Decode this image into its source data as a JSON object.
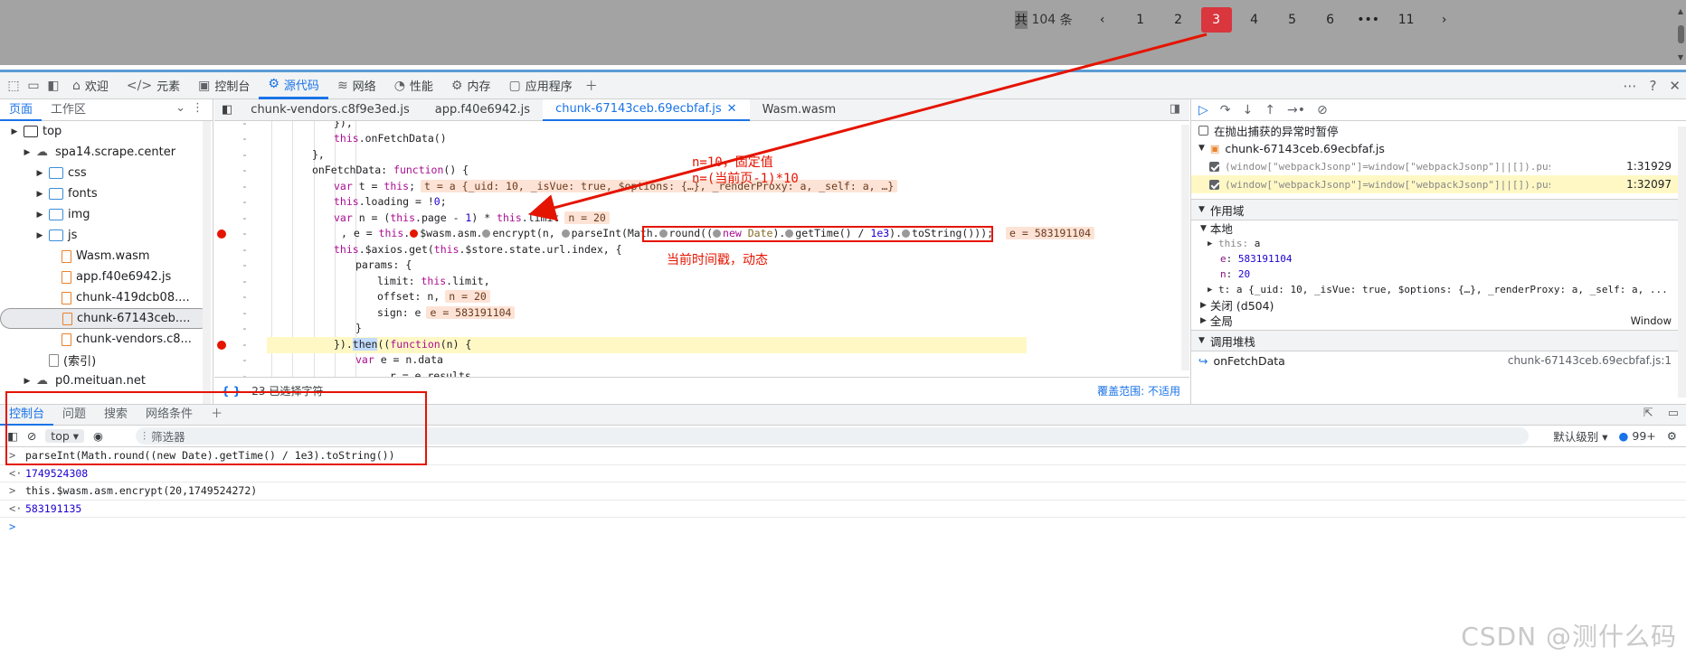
{
  "pagination": {
    "total_prefix": "共",
    "total_count": "104",
    "total_suffix": "条",
    "prev": "‹",
    "pages": [
      "1",
      "2",
      "3",
      "4",
      "5",
      "6",
      "•••",
      "11"
    ],
    "active": "3",
    "next": "›"
  },
  "devtools": {
    "main_tabs": [
      {
        "label": "欢迎",
        "icon": "⌂"
      },
      {
        "label": "元素",
        "icon": "</>"
      },
      {
        "label": "控制台",
        "icon": "▣"
      },
      {
        "label": "源代码",
        "icon": "⚙"
      },
      {
        "label": "网络",
        "icon": "≋"
      },
      {
        "label": "性能",
        "icon": "◔"
      },
      {
        "label": "内存",
        "icon": "⚙"
      },
      {
        "label": "应用程序",
        "icon": "▢"
      }
    ],
    "selected_main_tab": "源代码",
    "nav_tabs": [
      "页面",
      "工作区"
    ],
    "tree": [
      {
        "label": "top",
        "level": 0,
        "type": "frame",
        "arrow": "▶"
      },
      {
        "label": "spa14.scrape.center",
        "level": 1,
        "type": "cloud",
        "arrow": "▶"
      },
      {
        "label": "css",
        "level": 2,
        "type": "folder",
        "arrow": "▶"
      },
      {
        "label": "fonts",
        "level": 2,
        "type": "folder",
        "arrow": "▶"
      },
      {
        "label": "img",
        "level": 2,
        "type": "folder",
        "arrow": "▶"
      },
      {
        "label": "js",
        "level": 2,
        "type": "folder",
        "arrow": "▶"
      },
      {
        "label": "Wasm.wasm",
        "level": 3,
        "type": "file",
        "arrow": ""
      },
      {
        "label": "app.f40e6942.js",
        "level": 3,
        "type": "file",
        "arrow": ""
      },
      {
        "label": "chunk-419dcb08....",
        "level": 3,
        "type": "file",
        "arrow": ""
      },
      {
        "label": "chunk-67143ceb....",
        "level": 3,
        "type": "file",
        "arrow": "",
        "selected": true
      },
      {
        "label": "chunk-vendors.c8...",
        "level": 3,
        "type": "file",
        "arrow": ""
      },
      {
        "label": "(索引)",
        "level": 2,
        "type": "file-grey",
        "arrow": ""
      },
      {
        "label": "p0.meituan.net",
        "level": 1,
        "type": "cloud",
        "arrow": "▶"
      }
    ],
    "file_tabs": [
      {
        "label": "chunk-vendors.c8f9e3ed.js"
      },
      {
        "label": "app.f40e6942.js"
      },
      {
        "label": "chunk-67143ceb.69ecbfaf.js",
        "selected": true,
        "close": "✕"
      },
      {
        "label": "Wasm.wasm"
      }
    ],
    "editor_status": {
      "brace": "{ }",
      "selected": "23 已选择字符",
      "coverage": "覆盖范围: 不适用"
    },
    "annotations": {
      "n_note_1": "n=10，固定值",
      "n_note_2": "n=(当前页-1)*10",
      "ts_note": "当前时间戳，动态"
    },
    "debugger": {
      "pause_on_caught": "在抛出捕获的异常时暂停",
      "bp_file": "chunk-67143ceb.69ecbfaf.js",
      "breakpoints": [
        {
          "code": "(window[\"webpackJsonp\"]=window[\"webpackJsonp\"]||[]).push([[…",
          "loc": "1:31929"
        },
        {
          "code": "(window[\"webpackJsonp\"]=window[\"webpackJsonp\"]||[]).push([[…",
          "loc": "1:32097"
        }
      ],
      "scope_title": "作用域",
      "local_title": "本地",
      "vars": [
        {
          "name": "this",
          "value": "a",
          "dim": true
        },
        {
          "name": "e",
          "value": "583191104"
        },
        {
          "name": "n",
          "value": "20"
        }
      ],
      "t_var": "t: a {_uid: 10, _isVue: true, $options: {…}, _renderProxy: a, _self: a, ...",
      "closure": "关闭 (d504)",
      "global": "全局",
      "global_val": "Window",
      "callstack_title": "调用堆栈",
      "callstack": [
        {
          "fn": "onFetchData",
          "loc": "chunk-67143ceb.69ecbfaf.js:1"
        }
      ]
    },
    "drawer_tabs": [
      "控制台",
      "问题",
      "搜索",
      "网络条件"
    ],
    "console_toolbar": {
      "context": "top",
      "filter": "筛选器",
      "level": "默认级别",
      "count": "99+"
    },
    "console_lines": [
      {
        "prompt": ">",
        "text": "parseInt(Math.round((new Date).getTime() / 1e3).toString())"
      },
      {
        "prompt": "<·",
        "text": "1749524308",
        "output": true
      },
      {
        "prompt": ">",
        "text": "this.$wasm.asm.encrypt(20,1749524272)"
      },
      {
        "prompt": "<·",
        "text": "583191135",
        "output": true
      },
      {
        "prompt": ">",
        "text": ""
      }
    ]
  },
  "code": {
    "inline_t": "t = a {_uid: 10, _isVue: true, $options: {…}, _renderProxy: a, _self: a, …}",
    "inline_n": "n = 20",
    "inline_e": "e = 583191104",
    "inline_n2": "n = 20",
    "inline_e2": "e = 583191104"
  },
  "watermark": "CSDN @测什么码",
  "colors": {
    "accent": "#1a73e8",
    "annotation": "#e51400",
    "pager_active": "#d9363e"
  }
}
